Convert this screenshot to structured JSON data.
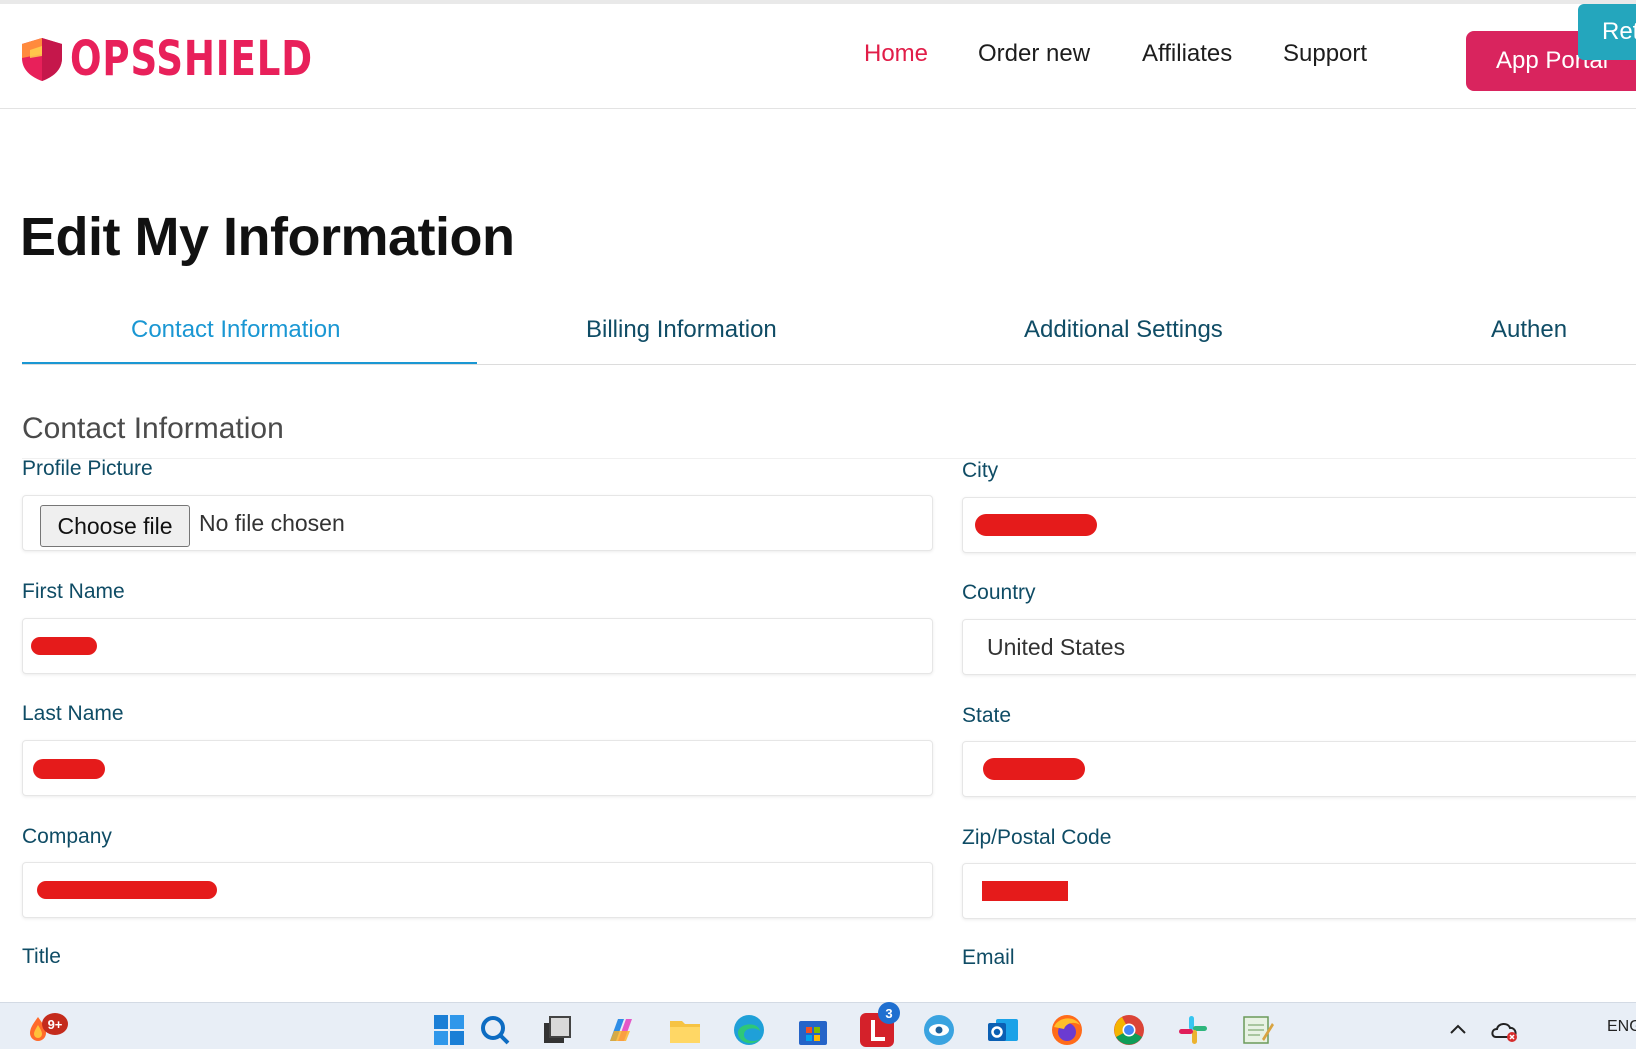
{
  "brand": {
    "name": "OPSSHIELD"
  },
  "nav": {
    "items": [
      {
        "label": "Home",
        "active": true
      },
      {
        "label": "Order new"
      },
      {
        "label": "Affiliates"
      },
      {
        "label": "Support"
      }
    ],
    "app_portal": "App Portal",
    "ret": "Ret"
  },
  "page": {
    "title": "Edit My Information"
  },
  "tabs": [
    {
      "label": "Contact Information",
      "active": true
    },
    {
      "label": "Billing Information"
    },
    {
      "label": "Additional Settings"
    },
    {
      "label": "Authen"
    }
  ],
  "section": {
    "title": "Contact Information"
  },
  "form": {
    "left": [
      {
        "label": "Profile Picture",
        "button": "Choose file",
        "status": "No file chosen"
      },
      {
        "label": "First Name"
      },
      {
        "label": "Last Name"
      },
      {
        "label": "Company"
      },
      {
        "label": "Title"
      }
    ],
    "right": [
      {
        "label": "City"
      },
      {
        "label": "Country",
        "value": "United States"
      },
      {
        "label": "State"
      },
      {
        "label": "Zip/Postal Code"
      },
      {
        "label": "Email"
      }
    ]
  },
  "taskbar": {
    "notification_badge": "9+",
    "app_badge": "3",
    "tray_text": "ENG"
  },
  "colors": {
    "brand": "#e8205a",
    "nav_active": "#e11d48",
    "app_portal_bg": "#d9245e",
    "ret_bg": "#24a6bd",
    "tab_active": "#1a97d3",
    "label": "#0f4c65",
    "redaction": "#e51b1b"
  }
}
